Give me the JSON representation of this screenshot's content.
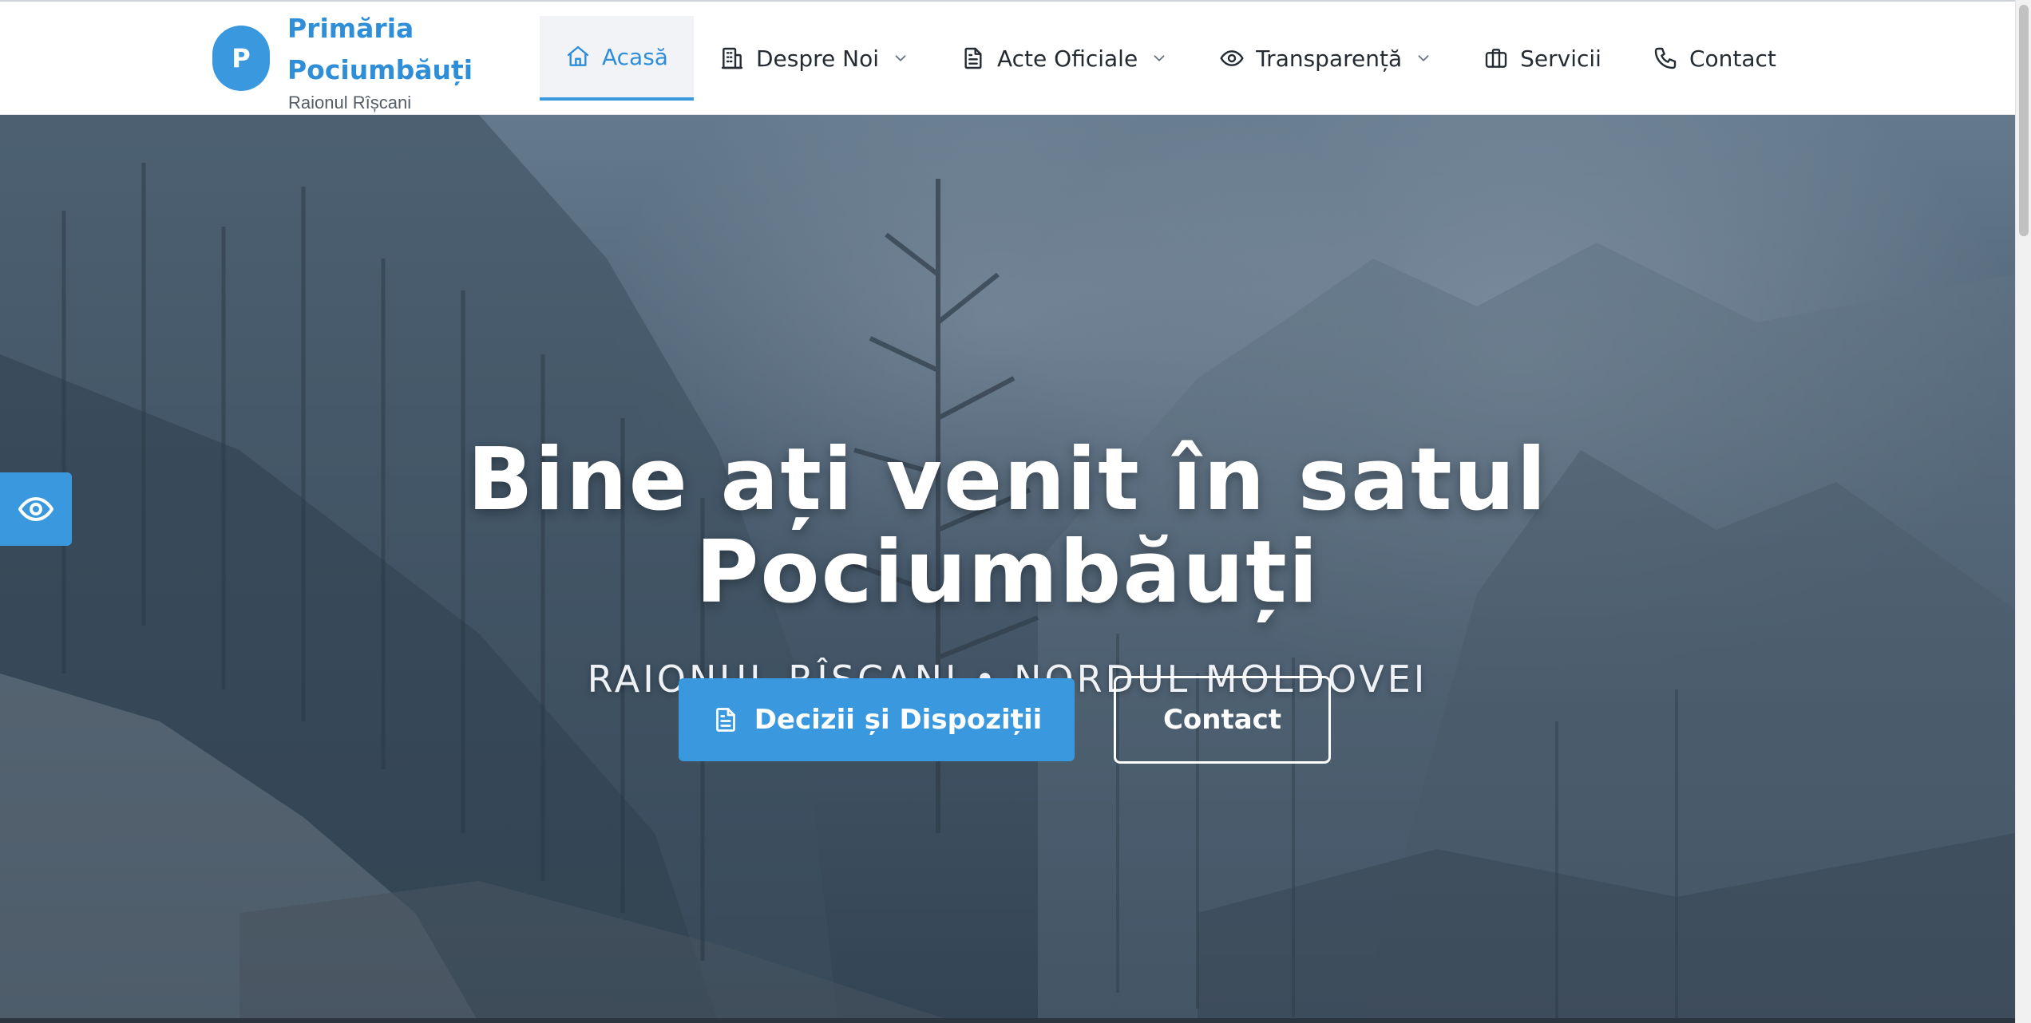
{
  "brand": {
    "logo_letter": "P",
    "name": "Primăria Pociumbăuți",
    "subtitle": "Raionul Rîșcani"
  },
  "nav": {
    "items": [
      {
        "label": "Acasă",
        "icon": "home-icon",
        "active": true,
        "dropdown": false
      },
      {
        "label": "Despre Noi",
        "icon": "building-icon",
        "active": false,
        "dropdown": true
      },
      {
        "label": "Acte Oficiale",
        "icon": "document-icon",
        "active": false,
        "dropdown": true
      },
      {
        "label": "Transparență",
        "icon": "eye-icon",
        "active": false,
        "dropdown": true
      },
      {
        "label": "Servicii",
        "icon": "briefcase-icon",
        "active": false,
        "dropdown": false
      },
      {
        "label": "Contact",
        "icon": "phone-icon",
        "active": false,
        "dropdown": false
      }
    ]
  },
  "hero": {
    "title_line1": "Bine ați venit în satul",
    "title_line2": "Pociumbăuți",
    "subtitle": "RAIONUL RÎȘCANI • NORDUL MOLDOVEI",
    "primary_button": "Decizii și Dispoziții",
    "secondary_button": "Contact"
  },
  "accessibility": {
    "icon": "eye-icon"
  },
  "colors": {
    "accent": "#3a98df",
    "brand_text": "#2f8ed8",
    "nav_text": "#252b33"
  }
}
